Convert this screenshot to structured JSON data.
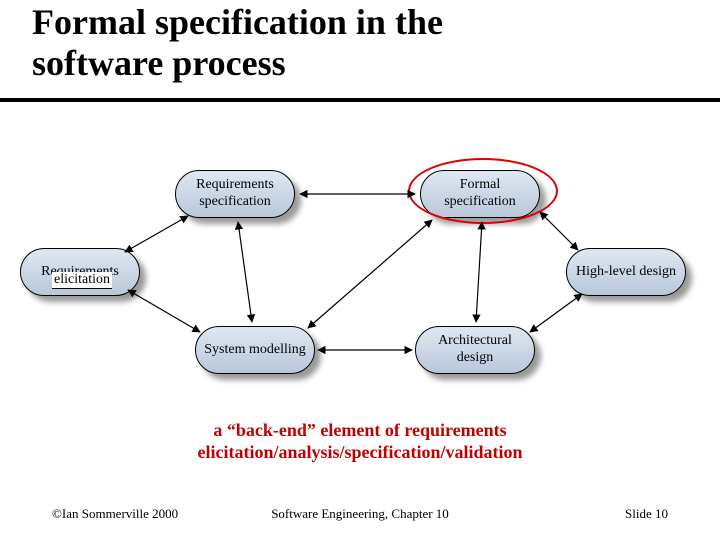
{
  "title": {
    "line1": "Formal specification in the",
    "line2": "software process"
  },
  "nodes": {
    "req_spec": "Requirements specification",
    "formal_spec": "Formal specification",
    "req_elicit": "Requirements",
    "req_elicit_overlay": "elicitation",
    "high_design": "High-level design",
    "sys_model": "System modelling",
    "arch_design": "Architectural design"
  },
  "note": {
    "line1": "a “back-end” element of requirements",
    "line2": "elicitation/analysis/specification/validation"
  },
  "footer": {
    "left": "©Ian Sommerville 2000",
    "center": "Software Engineering, Chapter 10",
    "right": "Slide 10"
  }
}
